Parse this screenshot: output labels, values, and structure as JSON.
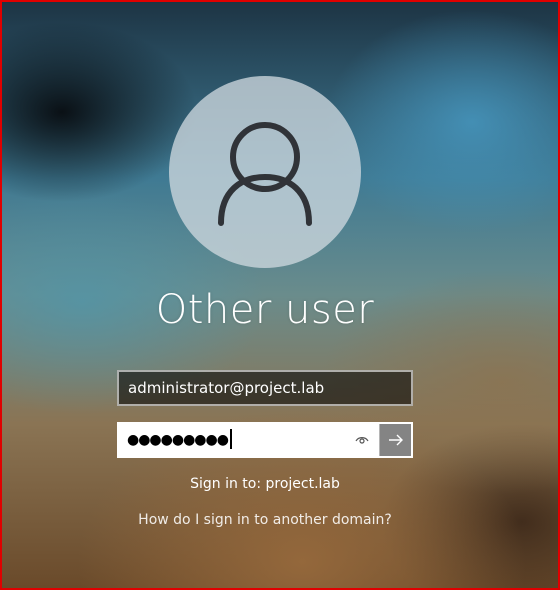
{
  "screen": {
    "user_title": "Other user",
    "frame_color": "#e00000"
  },
  "avatar": {
    "icon": "person-icon"
  },
  "username_field": {
    "value": "administrator@project.lab"
  },
  "password_field": {
    "masked_value": "●●●●●●●●●",
    "reveal_icon": "eye-icon",
    "submit_icon": "arrow-right-icon"
  },
  "signin_target": "Sign in to: project.lab",
  "other_domain_link": "How do I sign in to another domain?"
}
